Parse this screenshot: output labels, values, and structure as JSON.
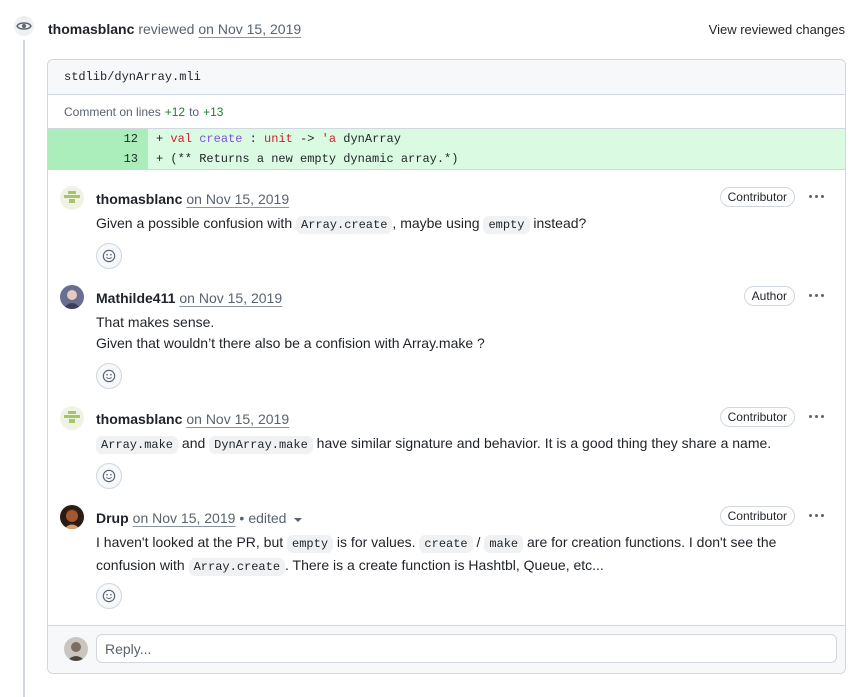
{
  "review": {
    "reviewer": "thomasblanc",
    "verb": "reviewed",
    "date": "on Nov 15, 2019",
    "view_changes": "View reviewed changes"
  },
  "thread": {
    "file_path": "stdlib/dynArray.mli",
    "lines_label_prefix": "Comment on lines",
    "line_start": "+12",
    "lines_to": "to",
    "line_end": "+13",
    "diff": [
      {
        "num": "12",
        "prefix": "+ ",
        "kw": "val",
        "name": "create",
        "rest": " : ",
        "type1": "unit",
        "arrow": " -> ",
        "type2": "'a",
        "tail": " dynArray"
      },
      {
        "num": "13",
        "text": "+ (** Returns a new empty dynamic array.*)"
      }
    ]
  },
  "comments": [
    {
      "author": "thomasblanc",
      "date": "on Nov 15, 2019",
      "badge": "Contributor",
      "body": {
        "p1": "Given a possible confusion with ",
        "c1": "Array.create",
        "p2": ", maybe using ",
        "c2": "empty",
        "p3": " instead?"
      }
    },
    {
      "author": "Mathilde411",
      "date": "on Nov 15, 2019",
      "badge": "Author",
      "body": {
        "line1": "That makes sense.",
        "line2": "Given that wouldn’t there also be a confision with Array.make ?"
      }
    },
    {
      "author": "thomasblanc",
      "date": "on Nov 15, 2019",
      "badge": "Contributor",
      "body": {
        "c1": "Array.make",
        "p1": " and ",
        "c2": "DynArray.make",
        "p2": " have similar signature and behavior. It is a good thing they share a name."
      }
    },
    {
      "author": "Drup",
      "date": "on Nov 15, 2019",
      "separator": "•",
      "edited": "edited",
      "badge": "Contributor",
      "body": {
        "p1": "I haven't looked at the PR, but ",
        "c1": "empty",
        "p2": " is for values. ",
        "c2": "create",
        "p3": " / ",
        "c3": "make",
        "p4": " are for creation functions. I don't see the confusion with ",
        "c4": "Array.create",
        "p5": ". There is a create function is Hashtbl, Queue, etc..."
      }
    }
  ],
  "reply": {
    "placeholder": "Reply..."
  },
  "icons": {
    "eye": "eye-icon",
    "smiley": "smiley-icon",
    "kebab": "kebab-horizontal-icon",
    "caret": "triangle-down-icon"
  },
  "colors": {
    "diff_added_bg": "#dafbe1",
    "diff_added_num_bg": "#aceebb",
    "border": "#d0d7de",
    "muted_text": "#59636e"
  }
}
